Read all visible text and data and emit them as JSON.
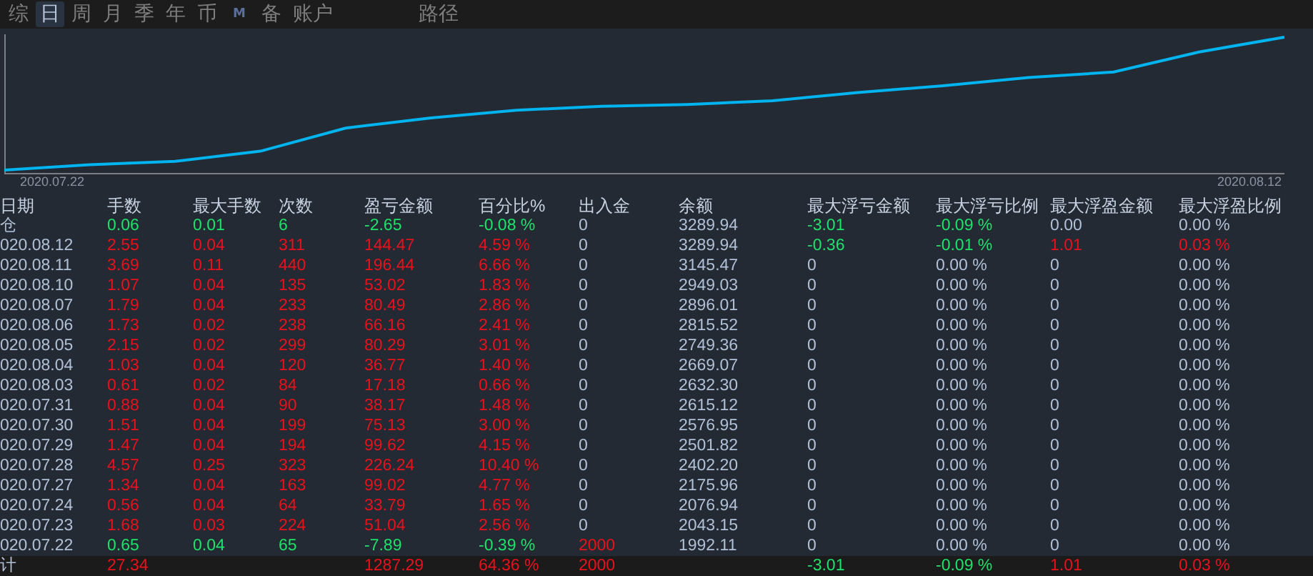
{
  "tabs": [
    {
      "label": "综",
      "kind": "text",
      "selected": false
    },
    {
      "label": "日",
      "kind": "text",
      "selected": true
    },
    {
      "label": "周",
      "kind": "text",
      "selected": false
    },
    {
      "label": "月",
      "kind": "text",
      "selected": false
    },
    {
      "label": "季",
      "kind": "text",
      "selected": false
    },
    {
      "label": "年",
      "kind": "text",
      "selected": false
    },
    {
      "label": "币",
      "kind": "text",
      "selected": false
    },
    {
      "label": "M",
      "kind": "letter",
      "selected": false
    },
    {
      "label": "备",
      "kind": "text",
      "selected": false
    },
    {
      "label": "账户",
      "kind": "text",
      "selected": false
    }
  ],
  "path_tab": {
    "label": "路径",
    "selected": false
  },
  "chart": {
    "x_start": "2020.07.22",
    "x_end": "2020.08.12"
  },
  "table": {
    "columns": [
      "日期",
      "手数",
      "最大手数",
      "次数",
      "盈亏金额",
      "百分比%",
      "出入金",
      "余额",
      "最大浮亏金额",
      "最大浮亏比例",
      "最大浮盈金额",
      "最大浮盈比例"
    ],
    "rows": [
      {
        "kind": "position",
        "cells": [
          {
            "text": "仓",
            "color": "#b0c0d6"
          },
          {
            "text": "0.06",
            "color": "#1ee26a"
          },
          {
            "text": "0.01",
            "color": "#1ee26a"
          },
          {
            "text": "6",
            "color": "#1ee26a"
          },
          {
            "text": "-2.65",
            "color": "#1ee26a"
          },
          {
            "text": "-0.08 %",
            "color": "#1ee26a"
          },
          {
            "text": "0",
            "color": "#b0c0d6"
          },
          {
            "text": "3289.94",
            "color": "#b0c0d6"
          },
          {
            "text": "-3.01",
            "color": "#1ee26a"
          },
          {
            "text": "-0.09 %",
            "color": "#1ee26a"
          },
          {
            "text": "0.00",
            "color": "#b0c0d6"
          },
          {
            "text": "0.00 %",
            "color": "#b0c0d6"
          }
        ]
      },
      {
        "kind": "day",
        "cells": [
          {
            "text": "020.08.12",
            "color": "#b0c0d6"
          },
          {
            "text": "2.55",
            "color": "#e8121c"
          },
          {
            "text": "0.04",
            "color": "#e8121c"
          },
          {
            "text": "311",
            "color": "#e8121c"
          },
          {
            "text": "144.47",
            "color": "#e8121c"
          },
          {
            "text": "4.59 %",
            "color": "#e8121c"
          },
          {
            "text": "0",
            "color": "#b0c0d6"
          },
          {
            "text": "3289.94",
            "color": "#b0c0d6"
          },
          {
            "text": "-0.36",
            "color": "#1ee26a"
          },
          {
            "text": "-0.01 %",
            "color": "#1ee26a"
          },
          {
            "text": "1.01",
            "color": "#e8121c"
          },
          {
            "text": "0.03 %",
            "color": "#e8121c"
          }
        ]
      },
      {
        "kind": "day",
        "cells": [
          {
            "text": "020.08.11",
            "color": "#b0c0d6"
          },
          {
            "text": "3.69",
            "color": "#e8121c"
          },
          {
            "text": "0.11",
            "color": "#e8121c"
          },
          {
            "text": "440",
            "color": "#e8121c"
          },
          {
            "text": "196.44",
            "color": "#e8121c"
          },
          {
            "text": "6.66 %",
            "color": "#e8121c"
          },
          {
            "text": "0",
            "color": "#b0c0d6"
          },
          {
            "text": "3145.47",
            "color": "#b0c0d6"
          },
          {
            "text": "0",
            "color": "#b0c0d6"
          },
          {
            "text": "0.00 %",
            "color": "#b0c0d6"
          },
          {
            "text": "0",
            "color": "#b0c0d6"
          },
          {
            "text": "0.00 %",
            "color": "#b0c0d6"
          }
        ]
      },
      {
        "kind": "day",
        "cells": [
          {
            "text": "020.08.10",
            "color": "#b0c0d6"
          },
          {
            "text": "1.07",
            "color": "#e8121c"
          },
          {
            "text": "0.04",
            "color": "#e8121c"
          },
          {
            "text": "135",
            "color": "#e8121c"
          },
          {
            "text": "53.02",
            "color": "#e8121c"
          },
          {
            "text": "1.83 %",
            "color": "#e8121c"
          },
          {
            "text": "0",
            "color": "#b0c0d6"
          },
          {
            "text": "2949.03",
            "color": "#b0c0d6"
          },
          {
            "text": "0",
            "color": "#b0c0d6"
          },
          {
            "text": "0.00 %",
            "color": "#b0c0d6"
          },
          {
            "text": "0",
            "color": "#b0c0d6"
          },
          {
            "text": "0.00 %",
            "color": "#b0c0d6"
          }
        ]
      },
      {
        "kind": "day",
        "cells": [
          {
            "text": "020.08.07",
            "color": "#b0c0d6"
          },
          {
            "text": "1.79",
            "color": "#e8121c"
          },
          {
            "text": "0.04",
            "color": "#e8121c"
          },
          {
            "text": "233",
            "color": "#e8121c"
          },
          {
            "text": "80.49",
            "color": "#e8121c"
          },
          {
            "text": "2.86 %",
            "color": "#e8121c"
          },
          {
            "text": "0",
            "color": "#b0c0d6"
          },
          {
            "text": "2896.01",
            "color": "#b0c0d6"
          },
          {
            "text": "0",
            "color": "#b0c0d6"
          },
          {
            "text": "0.00 %",
            "color": "#b0c0d6"
          },
          {
            "text": "0",
            "color": "#b0c0d6"
          },
          {
            "text": "0.00 %",
            "color": "#b0c0d6"
          }
        ]
      },
      {
        "kind": "day",
        "cells": [
          {
            "text": "020.08.06",
            "color": "#b0c0d6"
          },
          {
            "text": "1.73",
            "color": "#e8121c"
          },
          {
            "text": "0.02",
            "color": "#e8121c"
          },
          {
            "text": "238",
            "color": "#e8121c"
          },
          {
            "text": "66.16",
            "color": "#e8121c"
          },
          {
            "text": "2.41 %",
            "color": "#e8121c"
          },
          {
            "text": "0",
            "color": "#b0c0d6"
          },
          {
            "text": "2815.52",
            "color": "#b0c0d6"
          },
          {
            "text": "0",
            "color": "#b0c0d6"
          },
          {
            "text": "0.00 %",
            "color": "#b0c0d6"
          },
          {
            "text": "0",
            "color": "#b0c0d6"
          },
          {
            "text": "0.00 %",
            "color": "#b0c0d6"
          }
        ]
      },
      {
        "kind": "day",
        "cells": [
          {
            "text": "020.08.05",
            "color": "#b0c0d6"
          },
          {
            "text": "2.15",
            "color": "#e8121c"
          },
          {
            "text": "0.02",
            "color": "#e8121c"
          },
          {
            "text": "299",
            "color": "#e8121c"
          },
          {
            "text": "80.29",
            "color": "#e8121c"
          },
          {
            "text": "3.01 %",
            "color": "#e8121c"
          },
          {
            "text": "0",
            "color": "#b0c0d6"
          },
          {
            "text": "2749.36",
            "color": "#b0c0d6"
          },
          {
            "text": "0",
            "color": "#b0c0d6"
          },
          {
            "text": "0.00 %",
            "color": "#b0c0d6"
          },
          {
            "text": "0",
            "color": "#b0c0d6"
          },
          {
            "text": "0.00 %",
            "color": "#b0c0d6"
          }
        ]
      },
      {
        "kind": "day",
        "cells": [
          {
            "text": "020.08.04",
            "color": "#b0c0d6"
          },
          {
            "text": "1.03",
            "color": "#e8121c"
          },
          {
            "text": "0.04",
            "color": "#e8121c"
          },
          {
            "text": "120",
            "color": "#e8121c"
          },
          {
            "text": "36.77",
            "color": "#e8121c"
          },
          {
            "text": "1.40 %",
            "color": "#e8121c"
          },
          {
            "text": "0",
            "color": "#b0c0d6"
          },
          {
            "text": "2669.07",
            "color": "#b0c0d6"
          },
          {
            "text": "0",
            "color": "#b0c0d6"
          },
          {
            "text": "0.00 %",
            "color": "#b0c0d6"
          },
          {
            "text": "0",
            "color": "#b0c0d6"
          },
          {
            "text": "0.00 %",
            "color": "#b0c0d6"
          }
        ]
      },
      {
        "kind": "day",
        "cells": [
          {
            "text": "020.08.03",
            "color": "#b0c0d6"
          },
          {
            "text": "0.61",
            "color": "#e8121c"
          },
          {
            "text": "0.02",
            "color": "#e8121c"
          },
          {
            "text": "84",
            "color": "#e8121c"
          },
          {
            "text": "17.18",
            "color": "#e8121c"
          },
          {
            "text": "0.66 %",
            "color": "#e8121c"
          },
          {
            "text": "0",
            "color": "#b0c0d6"
          },
          {
            "text": "2632.30",
            "color": "#b0c0d6"
          },
          {
            "text": "0",
            "color": "#b0c0d6"
          },
          {
            "text": "0.00 %",
            "color": "#b0c0d6"
          },
          {
            "text": "0",
            "color": "#b0c0d6"
          },
          {
            "text": "0.00 %",
            "color": "#b0c0d6"
          }
        ]
      },
      {
        "kind": "day",
        "cells": [
          {
            "text": "020.07.31",
            "color": "#b0c0d6"
          },
          {
            "text": "0.88",
            "color": "#e8121c"
          },
          {
            "text": "0.04",
            "color": "#e8121c"
          },
          {
            "text": "90",
            "color": "#e8121c"
          },
          {
            "text": "38.17",
            "color": "#e8121c"
          },
          {
            "text": "1.48 %",
            "color": "#e8121c"
          },
          {
            "text": "0",
            "color": "#b0c0d6"
          },
          {
            "text": "2615.12",
            "color": "#b0c0d6"
          },
          {
            "text": "0",
            "color": "#b0c0d6"
          },
          {
            "text": "0.00 %",
            "color": "#b0c0d6"
          },
          {
            "text": "0",
            "color": "#b0c0d6"
          },
          {
            "text": "0.00 %",
            "color": "#b0c0d6"
          }
        ]
      },
      {
        "kind": "day",
        "cells": [
          {
            "text": "020.07.30",
            "color": "#b0c0d6"
          },
          {
            "text": "1.51",
            "color": "#e8121c"
          },
          {
            "text": "0.04",
            "color": "#e8121c"
          },
          {
            "text": "199",
            "color": "#e8121c"
          },
          {
            "text": "75.13",
            "color": "#e8121c"
          },
          {
            "text": "3.00 %",
            "color": "#e8121c"
          },
          {
            "text": "0",
            "color": "#b0c0d6"
          },
          {
            "text": "2576.95",
            "color": "#b0c0d6"
          },
          {
            "text": "0",
            "color": "#b0c0d6"
          },
          {
            "text": "0.00 %",
            "color": "#b0c0d6"
          },
          {
            "text": "0",
            "color": "#b0c0d6"
          },
          {
            "text": "0.00 %",
            "color": "#b0c0d6"
          }
        ]
      },
      {
        "kind": "day",
        "cells": [
          {
            "text": "020.07.29",
            "color": "#b0c0d6"
          },
          {
            "text": "1.47",
            "color": "#e8121c"
          },
          {
            "text": "0.04",
            "color": "#e8121c"
          },
          {
            "text": "194",
            "color": "#e8121c"
          },
          {
            "text": "99.62",
            "color": "#e8121c"
          },
          {
            "text": "4.15 %",
            "color": "#e8121c"
          },
          {
            "text": "0",
            "color": "#b0c0d6"
          },
          {
            "text": "2501.82",
            "color": "#b0c0d6"
          },
          {
            "text": "0",
            "color": "#b0c0d6"
          },
          {
            "text": "0.00 %",
            "color": "#b0c0d6"
          },
          {
            "text": "0",
            "color": "#b0c0d6"
          },
          {
            "text": "0.00 %",
            "color": "#b0c0d6"
          }
        ]
      },
      {
        "kind": "day",
        "cells": [
          {
            "text": "020.07.28",
            "color": "#b0c0d6"
          },
          {
            "text": "4.57",
            "color": "#e8121c"
          },
          {
            "text": "0.25",
            "color": "#e8121c"
          },
          {
            "text": "323",
            "color": "#e8121c"
          },
          {
            "text": "226.24",
            "color": "#e8121c"
          },
          {
            "text": "10.40 %",
            "color": "#e8121c"
          },
          {
            "text": "0",
            "color": "#b0c0d6"
          },
          {
            "text": "2402.20",
            "color": "#b0c0d6"
          },
          {
            "text": "0",
            "color": "#b0c0d6"
          },
          {
            "text": "0.00 %",
            "color": "#b0c0d6"
          },
          {
            "text": "0",
            "color": "#b0c0d6"
          },
          {
            "text": "0.00 %",
            "color": "#b0c0d6"
          }
        ]
      },
      {
        "kind": "day",
        "cells": [
          {
            "text": "020.07.27",
            "color": "#b0c0d6"
          },
          {
            "text": "1.34",
            "color": "#e8121c"
          },
          {
            "text": "0.04",
            "color": "#e8121c"
          },
          {
            "text": "163",
            "color": "#e8121c"
          },
          {
            "text": "99.02",
            "color": "#e8121c"
          },
          {
            "text": "4.77 %",
            "color": "#e8121c"
          },
          {
            "text": "0",
            "color": "#b0c0d6"
          },
          {
            "text": "2175.96",
            "color": "#b0c0d6"
          },
          {
            "text": "0",
            "color": "#b0c0d6"
          },
          {
            "text": "0.00 %",
            "color": "#b0c0d6"
          },
          {
            "text": "0",
            "color": "#b0c0d6"
          },
          {
            "text": "0.00 %",
            "color": "#b0c0d6"
          }
        ]
      },
      {
        "kind": "day",
        "cells": [
          {
            "text": "020.07.24",
            "color": "#b0c0d6"
          },
          {
            "text": "0.56",
            "color": "#e8121c"
          },
          {
            "text": "0.04",
            "color": "#e8121c"
          },
          {
            "text": "64",
            "color": "#e8121c"
          },
          {
            "text": "33.79",
            "color": "#e8121c"
          },
          {
            "text": "1.65 %",
            "color": "#e8121c"
          },
          {
            "text": "0",
            "color": "#b0c0d6"
          },
          {
            "text": "2076.94",
            "color": "#b0c0d6"
          },
          {
            "text": "0",
            "color": "#b0c0d6"
          },
          {
            "text": "0.00 %",
            "color": "#b0c0d6"
          },
          {
            "text": "0",
            "color": "#b0c0d6"
          },
          {
            "text": "0.00 %",
            "color": "#b0c0d6"
          }
        ]
      },
      {
        "kind": "day",
        "cells": [
          {
            "text": "020.07.23",
            "color": "#b0c0d6"
          },
          {
            "text": "1.68",
            "color": "#e8121c"
          },
          {
            "text": "0.03",
            "color": "#e8121c"
          },
          {
            "text": "224",
            "color": "#e8121c"
          },
          {
            "text": "51.04",
            "color": "#e8121c"
          },
          {
            "text": "2.56 %",
            "color": "#e8121c"
          },
          {
            "text": "0",
            "color": "#b0c0d6"
          },
          {
            "text": "2043.15",
            "color": "#b0c0d6"
          },
          {
            "text": "0",
            "color": "#b0c0d6"
          },
          {
            "text": "0.00 %",
            "color": "#b0c0d6"
          },
          {
            "text": "0",
            "color": "#b0c0d6"
          },
          {
            "text": "0.00 %",
            "color": "#b0c0d6"
          }
        ]
      },
      {
        "kind": "day",
        "cells": [
          {
            "text": "020.07.22",
            "color": "#b0c0d6"
          },
          {
            "text": "0.65",
            "color": "#1ee26a"
          },
          {
            "text": "0.04",
            "color": "#1ee26a"
          },
          {
            "text": "65",
            "color": "#1ee26a"
          },
          {
            "text": "-7.89",
            "color": "#1ee26a"
          },
          {
            "text": "-0.39 %",
            "color": "#1ee26a"
          },
          {
            "text": "2000",
            "color": "#e8121c"
          },
          {
            "text": "1992.11",
            "color": "#b0c0d6"
          },
          {
            "text": "0",
            "color": "#b0c0d6"
          },
          {
            "text": "0.00 %",
            "color": "#b0c0d6"
          },
          {
            "text": "0",
            "color": "#b0c0d6"
          },
          {
            "text": "0.00 %",
            "color": "#b0c0d6"
          }
        ]
      }
    ],
    "total": {
      "cells": [
        {
          "text": "计",
          "color": "#b0c0d6"
        },
        {
          "text": "27.34",
          "color": "#e8121c"
        },
        null,
        null,
        {
          "text": "1287.29",
          "color": "#e8121c"
        },
        {
          "text": "64.36 %",
          "color": "#e8121c"
        },
        {
          "text": "2000",
          "color": "#e8121c"
        },
        null,
        {
          "text": "-3.01",
          "color": "#1ee26a"
        },
        {
          "text": "-0.09 %",
          "color": "#1ee26a"
        },
        {
          "text": "1.01",
          "color": "#e8121c"
        },
        {
          "text": "0.03 %",
          "color": "#e8121c"
        }
      ]
    }
  }
}
